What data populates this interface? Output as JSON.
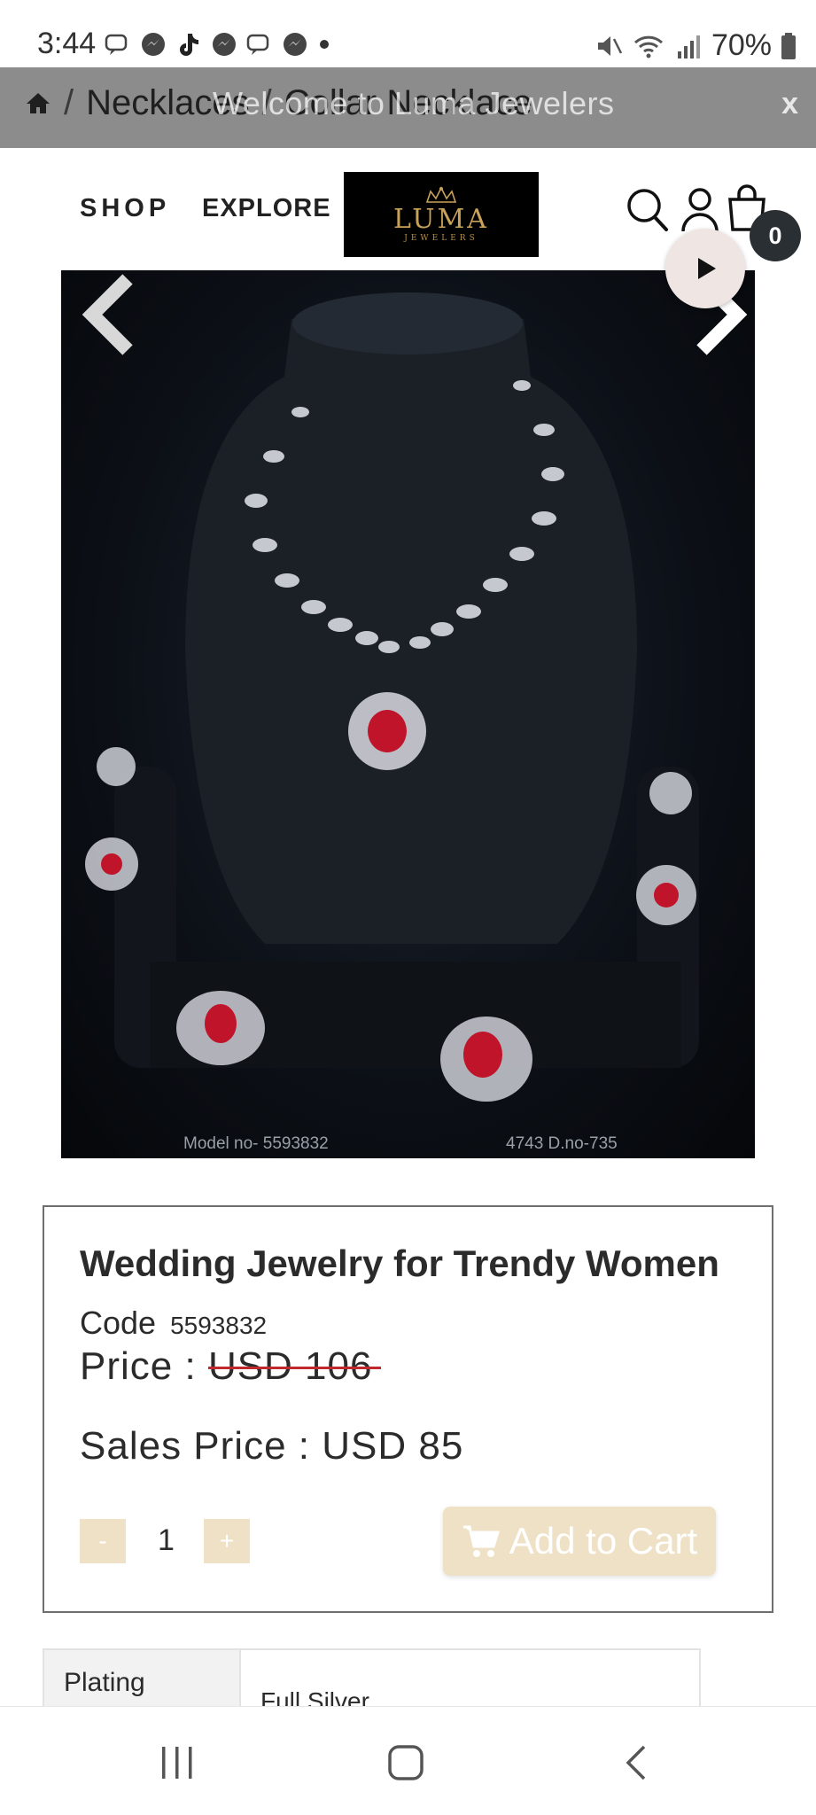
{
  "status_bar": {
    "time": "3:44",
    "battery": "70%",
    "left_icons": [
      "chat-bubble-icon",
      "messenger-icon",
      "tiktok-icon",
      "messenger-icon",
      "chat-bubble-icon",
      "messenger-icon",
      "dot-icon"
    ],
    "right_icons": [
      "mute-icon",
      "wifi-icon",
      "signal-icon",
      "battery-icon"
    ]
  },
  "announcement": {
    "breadcrumb": [
      "Necklaces",
      "Collar Necklace"
    ],
    "welcome_text": "Welcome to Luma Jewelers",
    "close_label": "x"
  },
  "header": {
    "nav_shop": "SHOP",
    "nav_explore": "EXPLORE",
    "logo_text": "LUMA",
    "logo_sub": "JEWELERS",
    "cart_count": "0",
    "icons": [
      "search-icon",
      "user-icon",
      "shopping-bag-icon",
      "play-icon"
    ]
  },
  "gallery": {
    "caption_left": "Model no- 5593832",
    "caption_right": "4743 D.no-735",
    "colors": {
      "background": "#0d1118",
      "stone": "#c0142a"
    }
  },
  "product": {
    "title": "Wedding Jewelry for Trendy Women",
    "code_label": "Code",
    "code_value": "5593832",
    "price_label": "Price :",
    "price_old": "USD 106",
    "sale_label": "Sales Price :",
    "sale_value": "USD 85",
    "qty_minus": "-",
    "qty_value": "1",
    "qty_plus": "+",
    "add_to_cart": "Add to Cart",
    "accent_color": "#efe1c6"
  },
  "specs": [
    {
      "label": "Plating",
      "value": "Full Silver"
    }
  ],
  "navbar": {
    "icons": [
      "recent-apps-icon",
      "home-icon",
      "back-icon"
    ]
  }
}
